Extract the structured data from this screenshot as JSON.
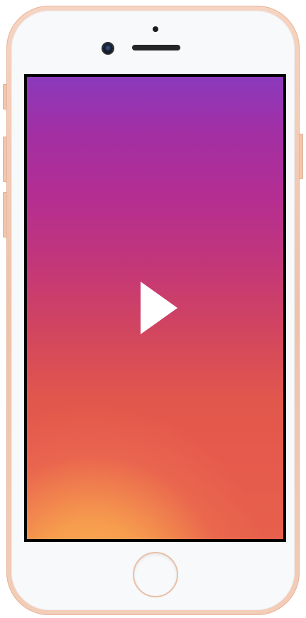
{
  "device": {
    "model_style": "rose-gold smartphone",
    "frame_color": "#f3cbb5",
    "face_color": "#f8f9fb",
    "icons": {
      "play": "play-icon",
      "camera": "front-camera-icon",
      "speaker": "earpiece-icon",
      "home": "home-button-icon"
    }
  },
  "screen": {
    "content": "video",
    "gradient_colors": [
      "#8b39bd",
      "#b42e92",
      "#d2455f",
      "#e65a4d",
      "#fbb44f"
    ],
    "play_icon_color": "#ffffff"
  }
}
